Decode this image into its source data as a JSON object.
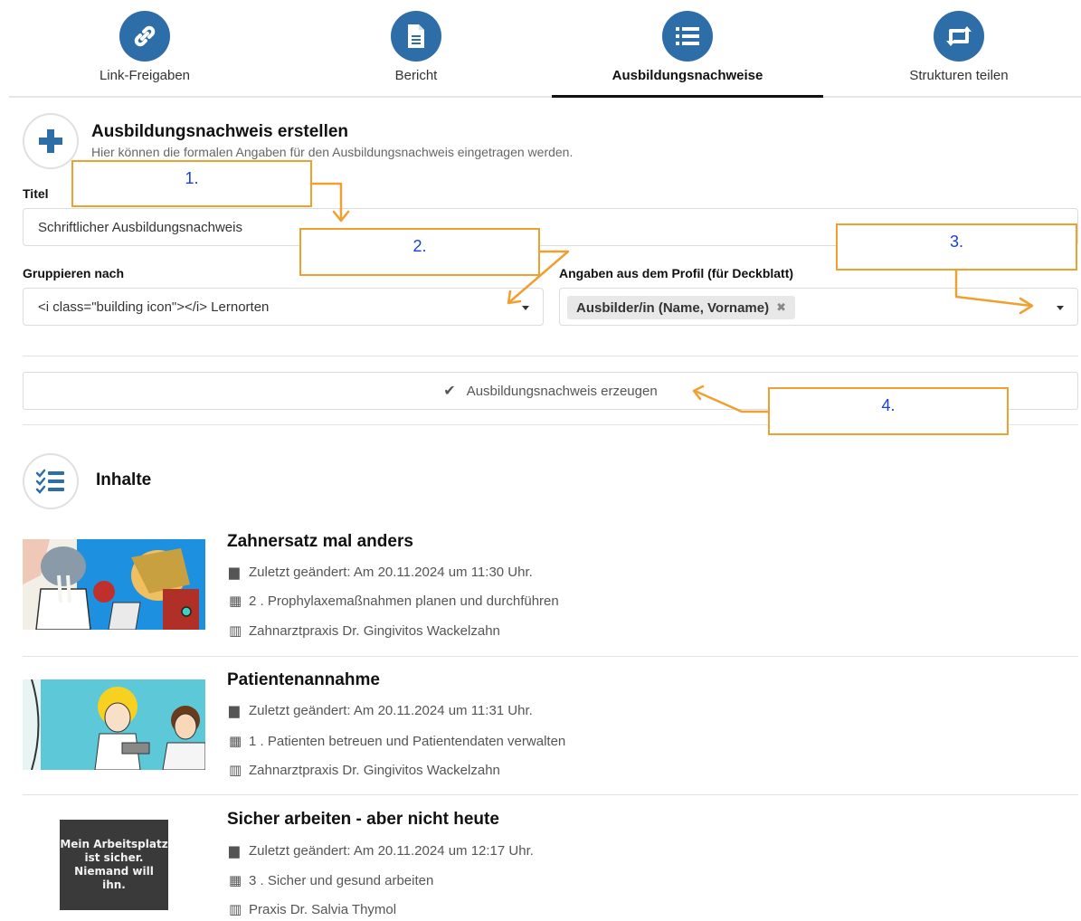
{
  "tabs": [
    {
      "label": "Link-Freigaben",
      "icon": "link-icon"
    },
    {
      "label": "Bericht",
      "icon": "document-icon"
    },
    {
      "label": "Ausbildungsnachweise",
      "icon": "list-icon",
      "active": true
    },
    {
      "label": "Strukturen teilen",
      "icon": "retweet-icon"
    }
  ],
  "create": {
    "title": "Ausbildungsnachweis erstellen",
    "subtitle": "Hier können die formalen Angaben für den Ausbildungsnachweis eingetragen werden."
  },
  "form": {
    "title_label": "Titel",
    "title_value": "Schriftlicher Ausbildungsnachweis",
    "group_label": "Gruppieren nach",
    "group_value": "<i class=\"building icon\"></i> Lernorten",
    "profile_label": "Angaben aus dem Profil (für Deckblatt)",
    "profile_chip": "Ausbilder/in (Name, Vorname)",
    "chip_remove": "✖",
    "generate_label": "Ausbildungsnachweis erzeugen"
  },
  "annotations": [
    "1.",
    "2.",
    "3.",
    "4."
  ],
  "contents": {
    "title": "Inhalte",
    "items": [
      {
        "title": "Zahnersatz mal anders",
        "changed": "Zuletzt geändert: Am 20.11.2024 um 11:30 Uhr.",
        "field": "2 . Prophylaxemaßnahmen planen und durchführen",
        "place": "Zahnarztpraxis Dr. Gingivitos Wackelzahn"
      },
      {
        "title": "Patientenannahme",
        "changed": "Zuletzt geändert: Am 20.11.2024 um 11:31 Uhr.",
        "field": "1 . Patienten betreuen und Patientendaten verwalten",
        "place": "Zahnarztpraxis Dr. Gingivitos Wackelzahn"
      },
      {
        "title": "Sicher arbeiten - aber nicht heute",
        "changed": "Zuletzt geändert: Am 20.11.2024 um 12:17 Uhr.",
        "field": "3 . Sicher und gesund arbeiten",
        "place": "Praxis Dr. Salvia Thymol",
        "thumb_text": [
          "Mein Arbeitsplatz",
          "ist sicher.",
          "Niemand will",
          "ihn."
        ]
      }
    ]
  },
  "colors": {
    "accent": "#2d6da8",
    "annotation_border": "#f0a030",
    "annotation_text": "#1a3fe0"
  }
}
